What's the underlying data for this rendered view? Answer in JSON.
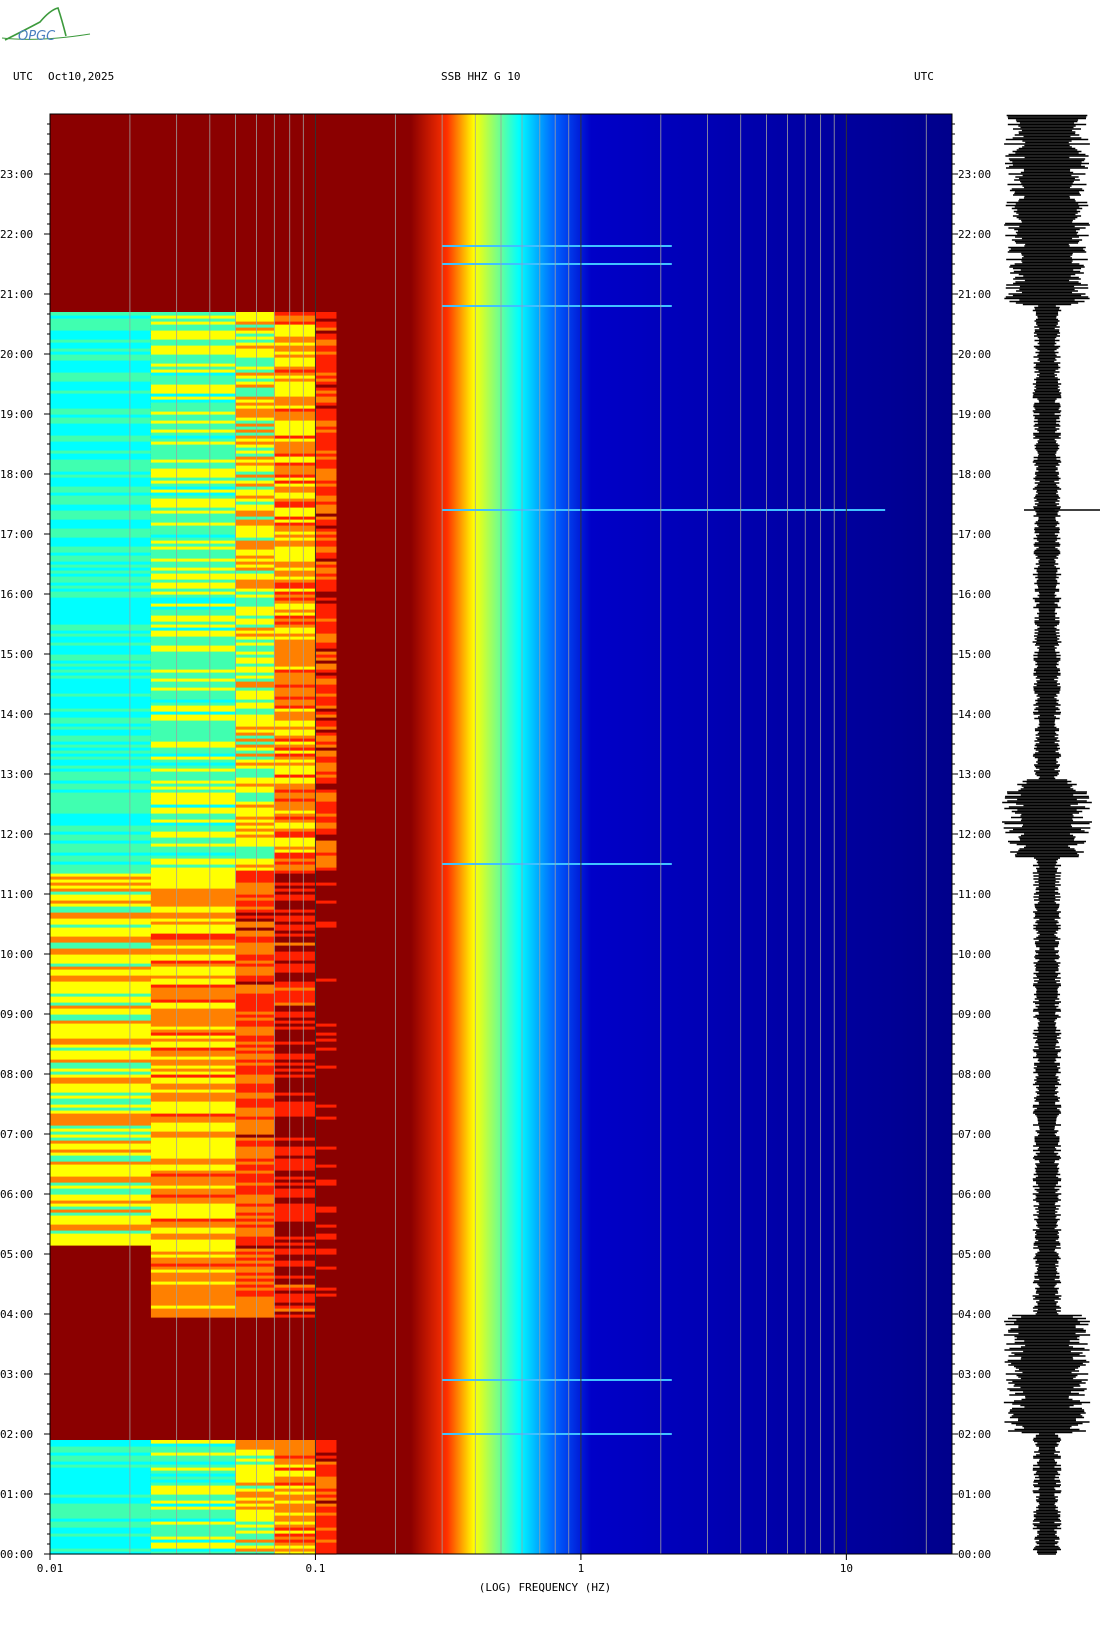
{
  "header": {
    "left_tz": "UTC",
    "date": "Oct10,2025",
    "station": "SSB HHZ G 10",
    "right_tz": "UTC"
  },
  "logo": {
    "text": "OPGC"
  },
  "chart_data": {
    "type": "heatmap",
    "title": "SSB HHZ G 10",
    "xlabel": "(LOG) FREQUENCY (HZ)",
    "x_scale": "log",
    "xlim": [
      0.01,
      25
    ],
    "x_ticks": [
      0.01,
      0.1,
      1,
      10
    ],
    "x_tick_labels": [
      "0.01",
      "0.1",
      "1",
      "10"
    ],
    "ylim_hours": [
      0,
      24
    ],
    "y_tick_labels": [
      "00:00",
      "01:00",
      "02:00",
      "03:00",
      "04:00",
      "05:00",
      "06:00",
      "07:00",
      "08:00",
      "09:00",
      "10:00",
      "11:00",
      "12:00",
      "13:00",
      "14:00",
      "15:00",
      "16:00",
      "17:00",
      "18:00",
      "19:00",
      "20:00",
      "21:00",
      "22:00",
      "23:00"
    ],
    "grid": true,
    "colors": {
      "background": "#8b0000",
      "low": "#00008b",
      "mid": "#00bfff",
      "high": "#ffff00"
    },
    "events_utc_hours": [
      2.0,
      2.9,
      11.5,
      17.4,
      20.8,
      21.5,
      21.8
    ],
    "waveform_trace": true
  }
}
